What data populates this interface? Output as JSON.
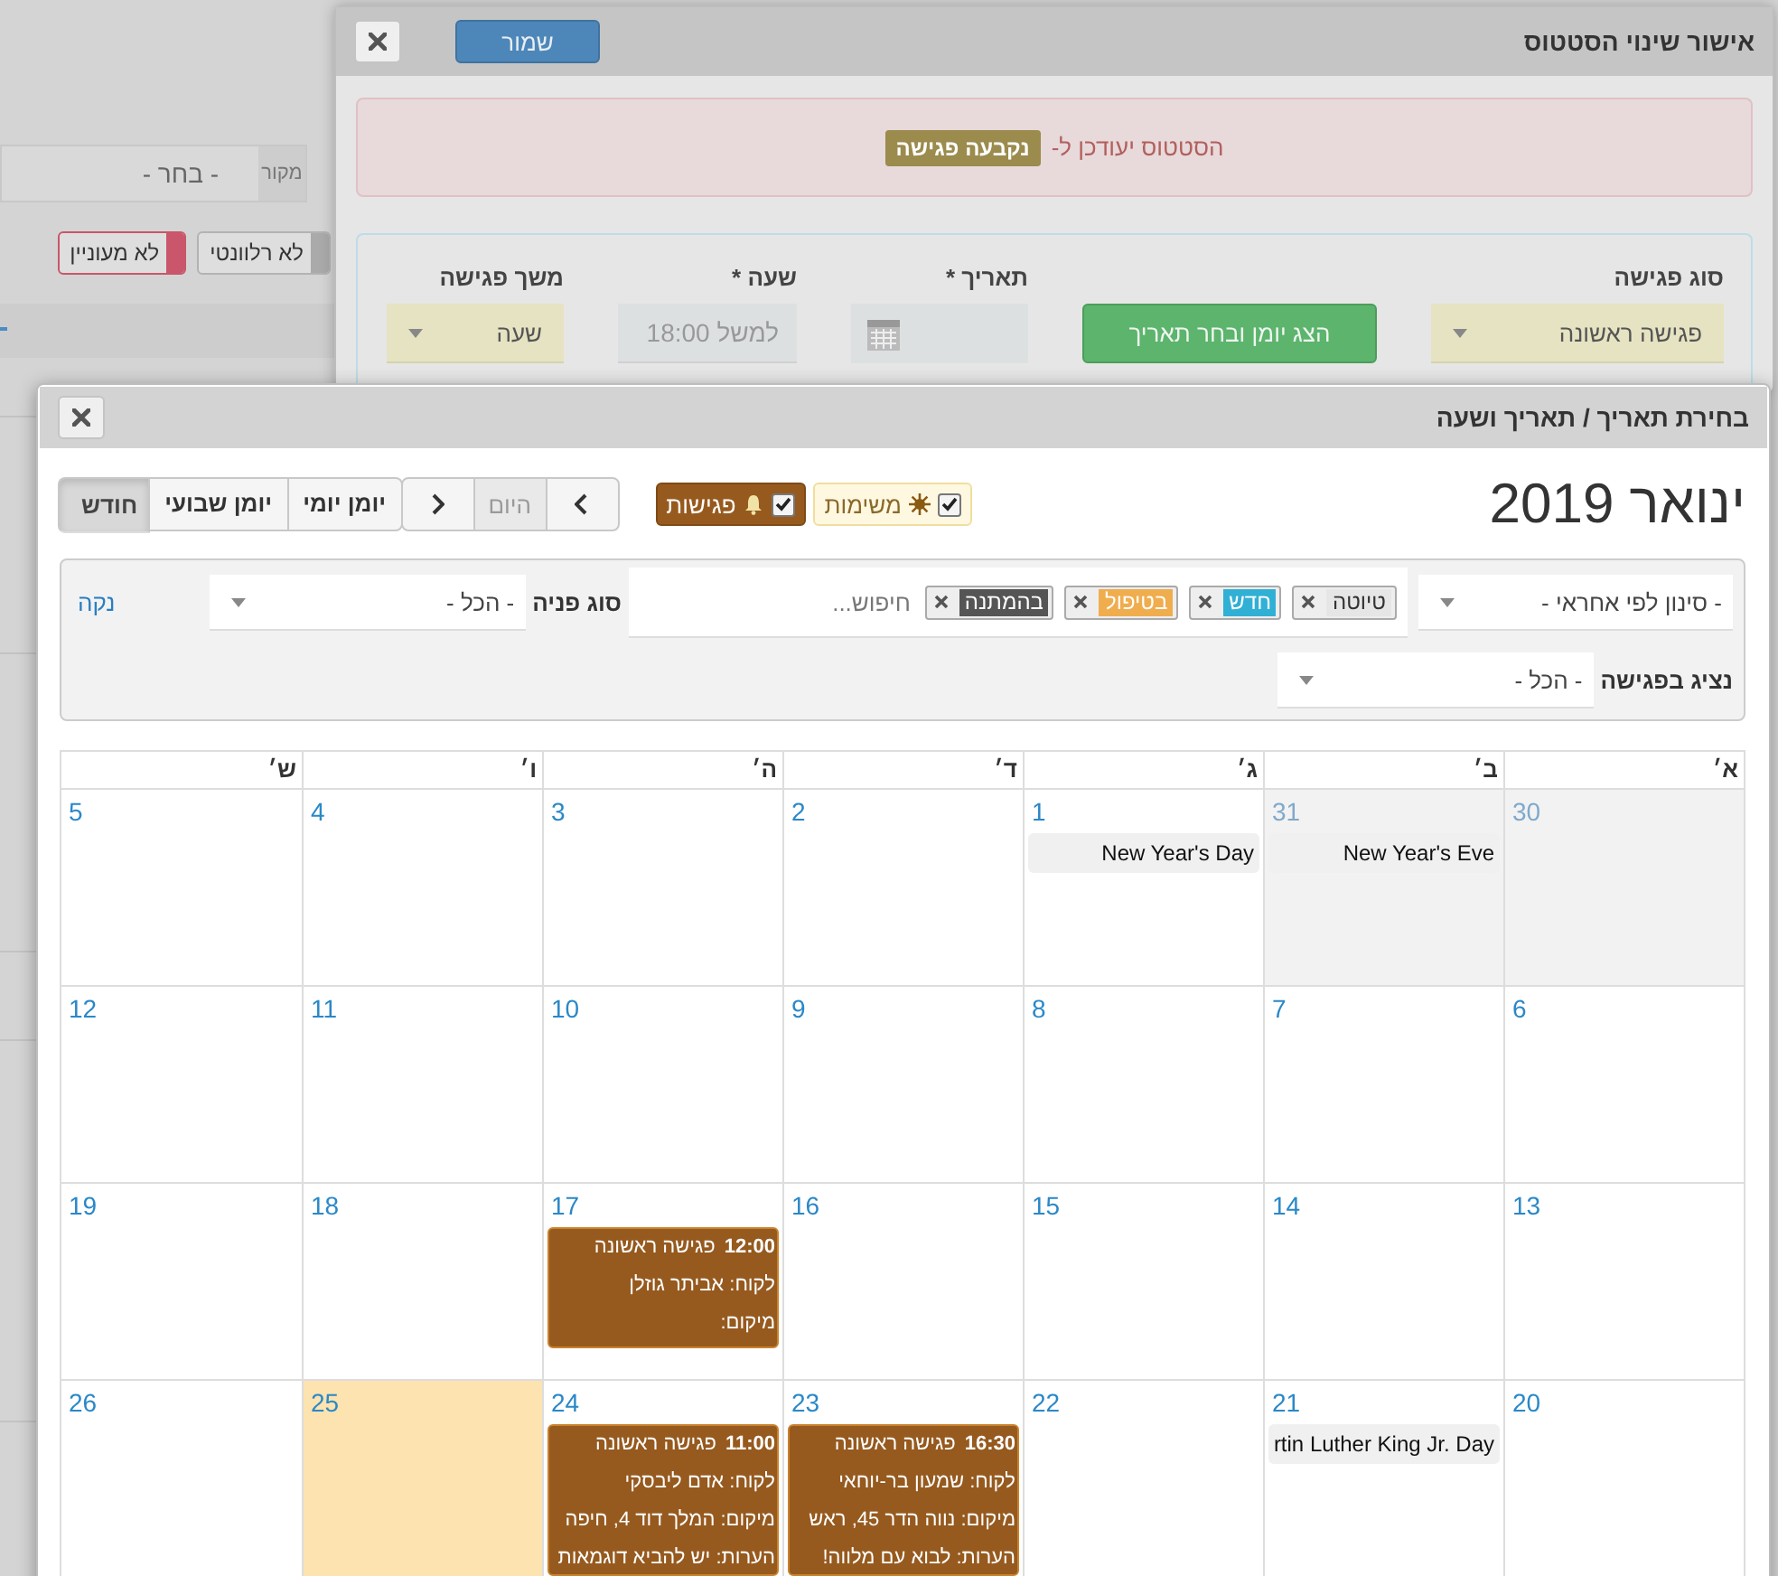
{
  "background_page": {
    "source_label": "מקור",
    "source_value": "- בחר -",
    "tags": [
      {
        "label": "לא רלוונטי",
        "color": "#aaaaaa"
      },
      {
        "label": "לא מעוניין",
        "color": "#c9566a"
      }
    ]
  },
  "status_dialog": {
    "title": "אישור שינוי הסטטוס",
    "save_button": "שמור",
    "alert": {
      "text": "הסטטוס יעודכן ל-",
      "badge": "נקבעה פגישה"
    },
    "fields": [
      {
        "kind": "select",
        "label": "סוג פגישה",
        "value": "פגישה ראשונה"
      },
      {
        "kind": "action",
        "value": "הצג יומן ובחר תאריך"
      },
      {
        "kind": "date",
        "label": "תאריך *"
      },
      {
        "kind": "time",
        "label": "שעה *",
        "placeholder": "למשל 18:00"
      },
      {
        "kind": "select",
        "label": "משך פגישה",
        "value": "שעה"
      }
    ]
  },
  "calendar_dialog": {
    "title": "בחירת תאריך / תאריך ושעה",
    "month_title": "ינואר 2019",
    "toggles": [
      {
        "kind": "tasks",
        "label": "משימות",
        "checked": true
      },
      {
        "kind": "meetings",
        "label": "פגישות",
        "checked": true
      }
    ],
    "today_button": {
      "label": "היום",
      "disabled": true
    },
    "views": [
      {
        "label": "יומן יומי",
        "selected": false
      },
      {
        "label": "יומן שבועי",
        "selected": false
      },
      {
        "label": "חודש",
        "selected": true
      }
    ],
    "filters": {
      "owner_value": "- סינון לפי אחראי -",
      "status_tags": [
        {
          "label": "טיוטה",
          "color": "#e6e6e6"
        },
        {
          "label": "חדש",
          "color": "#31b0d5"
        },
        {
          "label": "בטיפול",
          "color": "#f0ad4e"
        },
        {
          "label": "בהמתנה",
          "color": "#555555"
        }
      ],
      "search_placeholder": "חיפוש...",
      "type_label": "סוג פניה",
      "type_value": "- הכל -",
      "clear_link": "נקה",
      "rep_label": "נציג בפגישה",
      "rep_value": "- הכל -"
    },
    "weekdays": [
      "א׳",
      "ב׳",
      "ג׳",
      "ד׳",
      "ה׳",
      "ו׳",
      "ש׳"
    ],
    "weeks": [
      [
        {
          "day": "30",
          "other_month": true,
          "today": false
        },
        {
          "day": "31",
          "other_month": true,
          "today": false,
          "events": [
            {
              "kind": "holiday",
              "title": "New Year's Eve"
            }
          ]
        },
        {
          "day": "1",
          "other_month": false,
          "today": false,
          "events": [
            {
              "kind": "holiday",
              "title": "New Year's Day"
            }
          ]
        },
        {
          "day": "2",
          "other_month": false,
          "today": false
        },
        {
          "day": "3",
          "other_month": false,
          "today": false
        },
        {
          "day": "4",
          "other_month": false,
          "today": false
        },
        {
          "day": "5",
          "other_month": false,
          "today": false
        }
      ],
      [
        {
          "day": "6",
          "other_month": false,
          "today": false
        },
        {
          "day": "7",
          "other_month": false,
          "today": false
        },
        {
          "day": "8",
          "other_month": false,
          "today": false
        },
        {
          "day": "9",
          "other_month": false,
          "today": false
        },
        {
          "day": "10",
          "other_month": false,
          "today": false
        },
        {
          "day": "11",
          "other_month": false,
          "today": false
        },
        {
          "day": "12",
          "other_month": false,
          "today": false
        }
      ],
      [
        {
          "day": "13",
          "other_month": false,
          "today": false
        },
        {
          "day": "14",
          "other_month": false,
          "today": false
        },
        {
          "day": "15",
          "other_month": false,
          "today": false
        },
        {
          "day": "16",
          "other_month": false,
          "today": false
        },
        {
          "day": "17",
          "other_month": false,
          "today": false,
          "events": [
            {
              "kind": "meeting",
              "time": "12:00",
              "title": "פגישה ראשונה",
              "lines": [
                "לקוח: אביתר גוזלן",
                "מיקום:"
              ]
            }
          ]
        },
        {
          "day": "18",
          "other_month": false,
          "today": false
        },
        {
          "day": "19",
          "other_month": false,
          "today": false
        }
      ],
      [
        {
          "day": "20",
          "other_month": false,
          "today": false
        },
        {
          "day": "21",
          "other_month": false,
          "today": false,
          "events": [
            {
              "kind": "holiday",
              "title": "rtin Luther King Jr. Day"
            }
          ]
        },
        {
          "day": "22",
          "other_month": false,
          "today": false
        },
        {
          "day": "23",
          "other_month": false,
          "today": false,
          "events": [
            {
              "kind": "meeting",
              "time": "16:30",
              "title": "פגישה ראשונה",
              "lines": [
                "לקוח: שמעון בר-יוחאי",
                "מיקום: נווה הדר 45, ראש",
                "הערות: לבוא עם מלווה!"
              ]
            }
          ]
        },
        {
          "day": "24",
          "other_month": false,
          "today": false,
          "events": [
            {
              "kind": "meeting",
              "time": "11:00",
              "title": "פגישה ראשונה",
              "lines": [
                "לקוח: אדם ליבסקי",
                "מיקום: המלך דוד 4, חיפה",
                "הערות: יש להביא דוגמאות"
              ]
            }
          ]
        },
        {
          "day": "25",
          "other_month": false,
          "today": true
        },
        {
          "day": "26",
          "other_month": false,
          "today": false
        }
      ]
    ]
  }
}
